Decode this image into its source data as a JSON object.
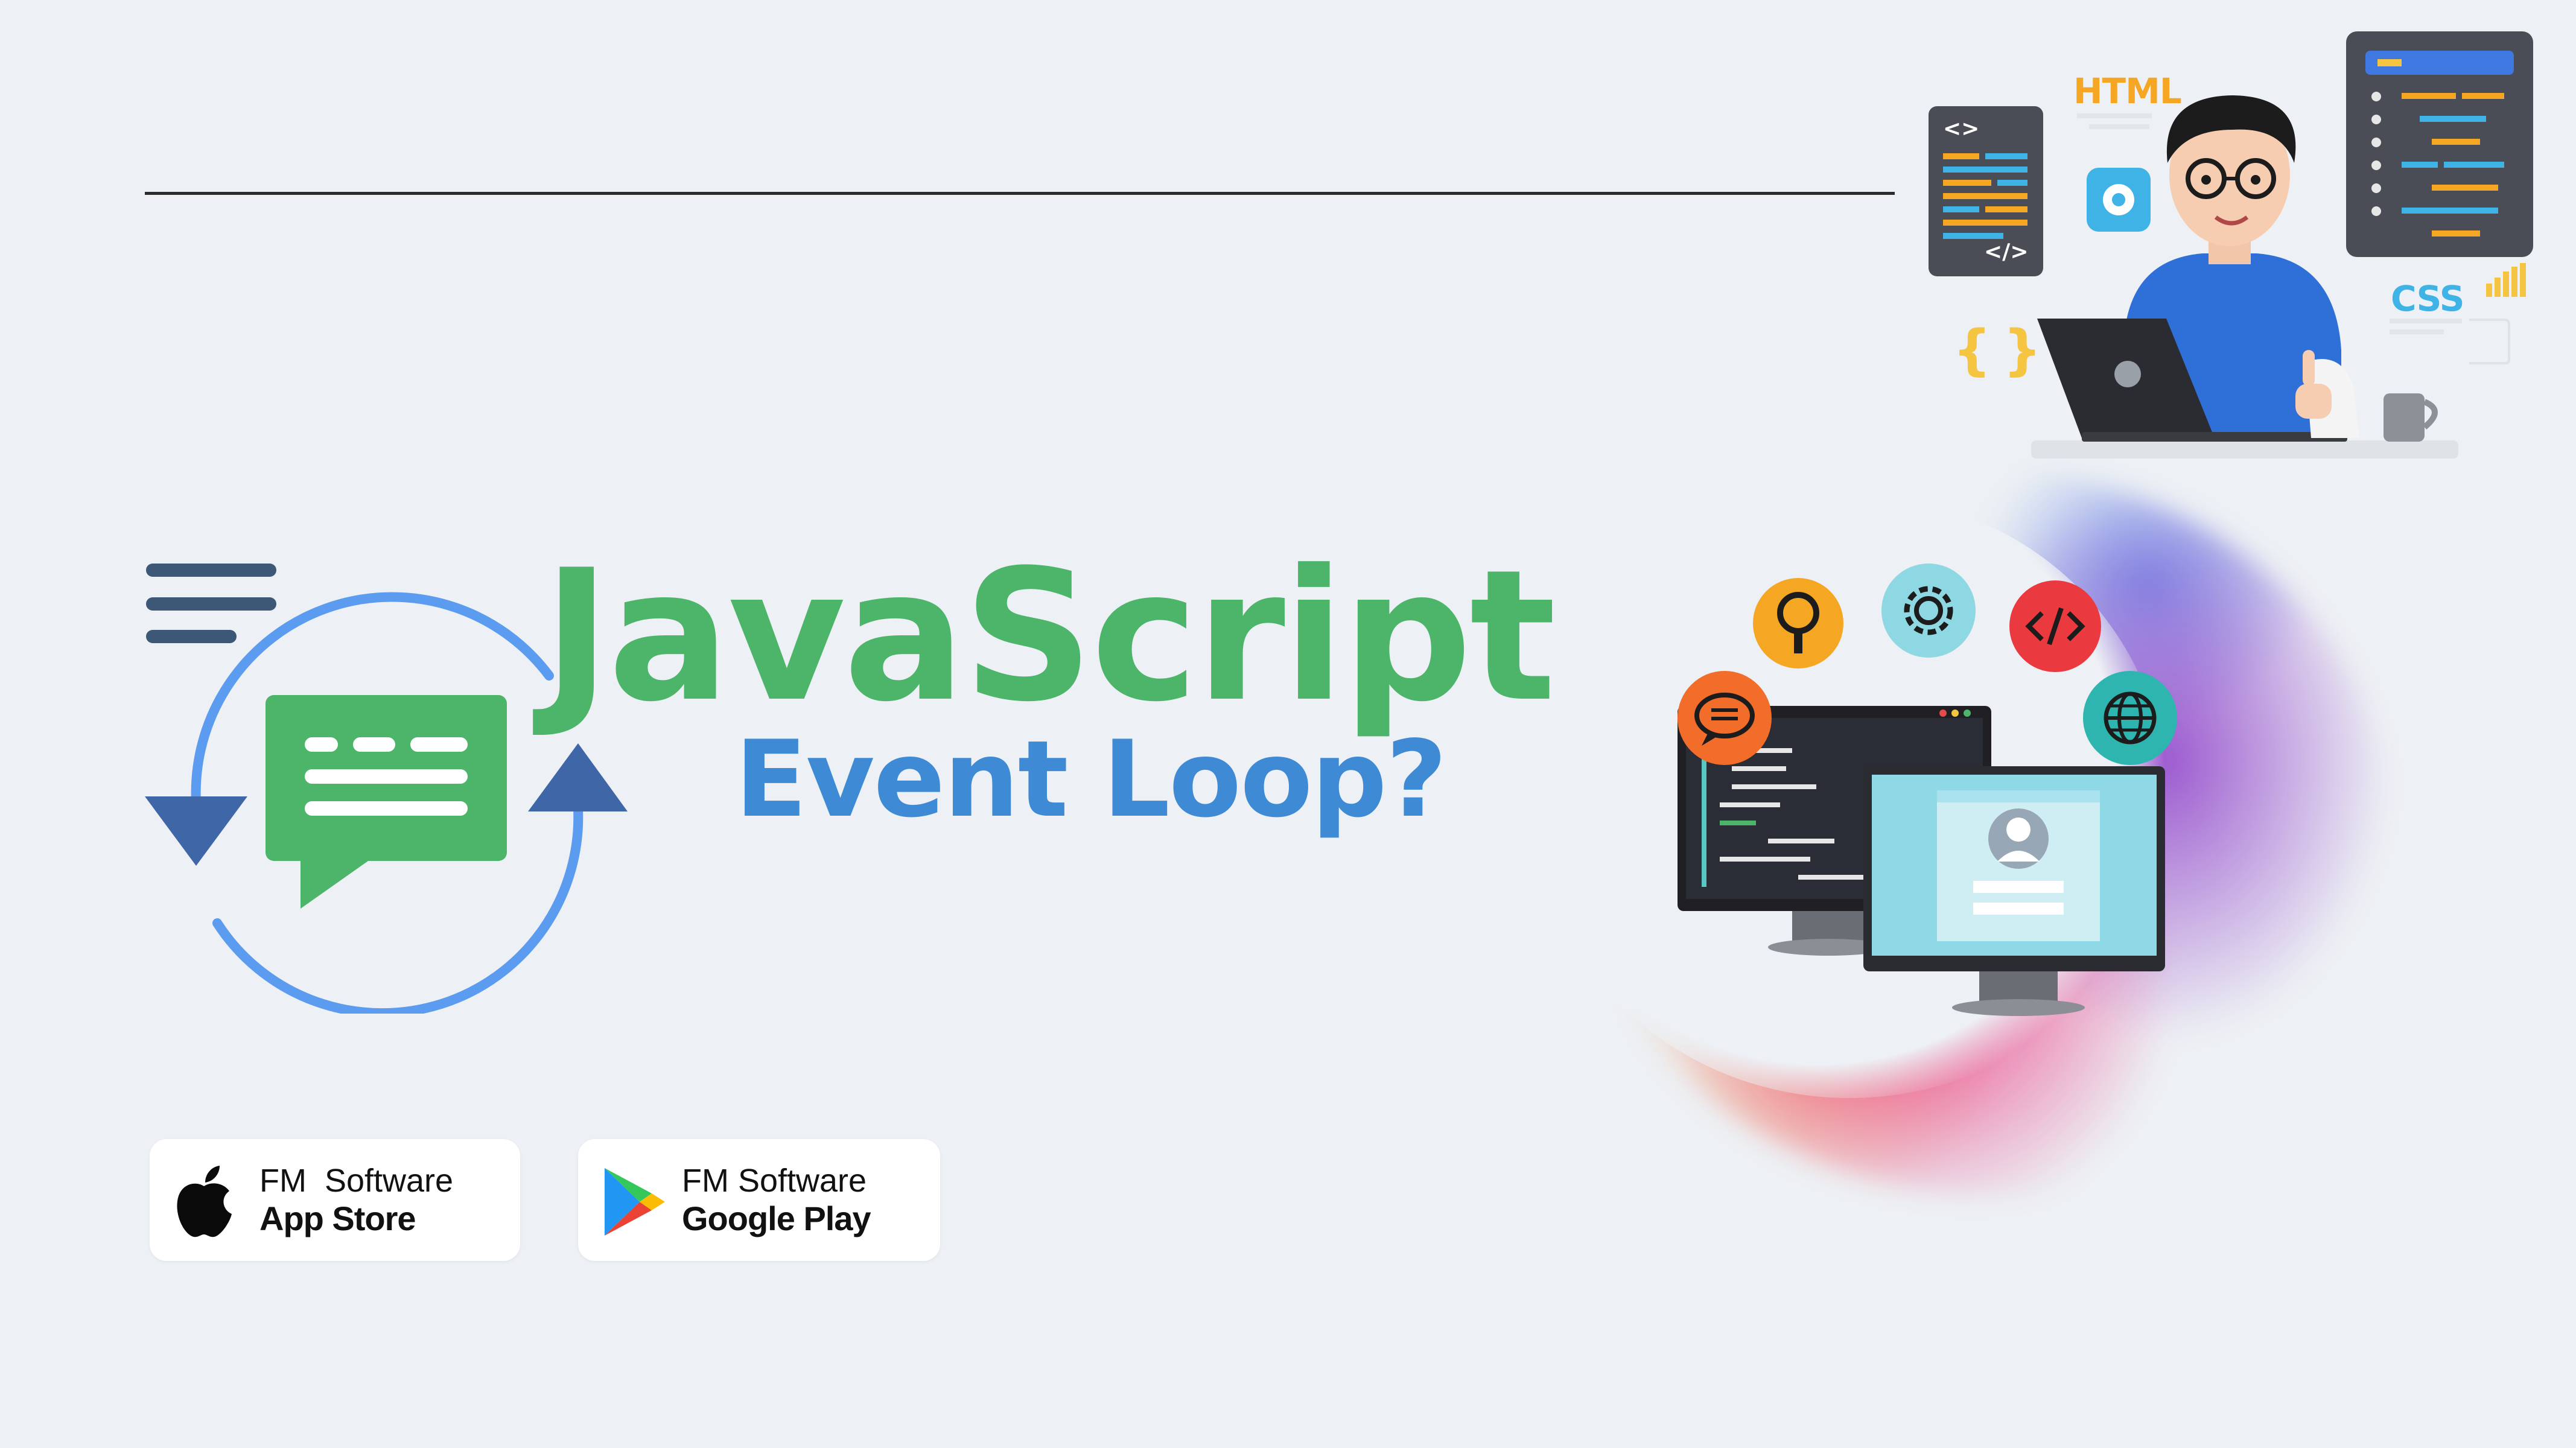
{
  "title": {
    "main": "JavaScript",
    "sub": "Event Loop?"
  },
  "stores": [
    {
      "brand": "FM  Software",
      "name": "App Store",
      "icon": "apple-icon"
    },
    {
      "brand": "FM Software",
      "name": "Google Play",
      "icon": "google-play-icon"
    }
  ],
  "illustration": {
    "html_label": "HTML",
    "css_label": "CSS",
    "braces_label": "{ }",
    "code_tag_label": "</>",
    "angle_label": "<>",
    "icons": [
      "search-icon",
      "gear-icon",
      "code-icon",
      "chat-icon",
      "globe-icon",
      "hamburger-menu-icon",
      "chat-bubble-icon",
      "cycle-arrows-icon"
    ]
  },
  "colors": {
    "background": "#edf0f4",
    "green": "#4cb56a",
    "blue": "#3f8ad4",
    "loop_blue": "#5b9cf0",
    "arrow_navy": "#3f67a8"
  }
}
